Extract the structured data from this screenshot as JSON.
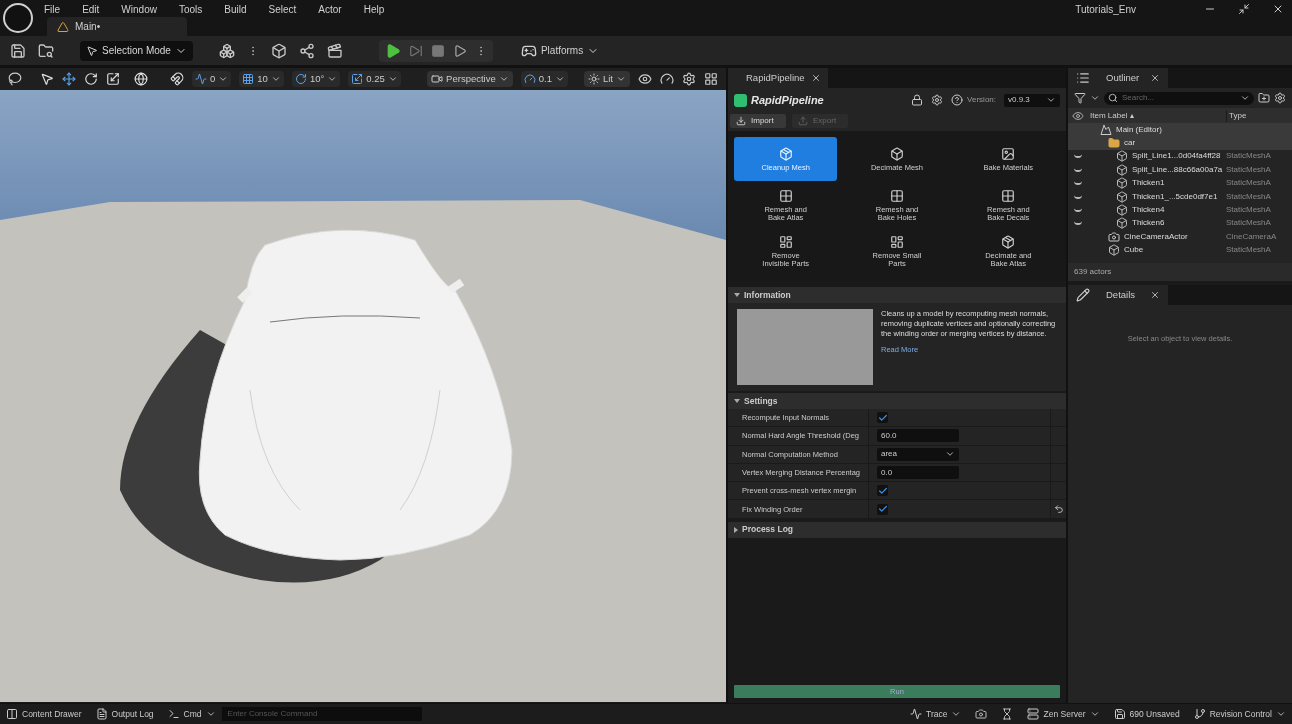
{
  "window": {
    "title": "Tutorials_Env"
  },
  "menu": [
    "File",
    "Edit",
    "Window",
    "Tools",
    "Build",
    "Select",
    "Actor",
    "Help"
  ],
  "document_tab": {
    "label": "Main•"
  },
  "toolbar": {
    "mode": "Selection Mode",
    "platforms": "Platforms"
  },
  "viewport_toolbar": {
    "rotate_snap": "0",
    "grid_snap": "10",
    "angle_snap": "10°",
    "scale_snap": "0.25",
    "view": "Perspective",
    "camera_speed": "0.1",
    "view_mode": "Lit"
  },
  "rapid_pipeline": {
    "tab": "RapidPipeline",
    "logo_text": "RapidPipeline",
    "version_label": "Version:",
    "version": "v0.9.3",
    "actions": [
      {
        "label": "Import",
        "disabled": false
      },
      {
        "label": "Export",
        "disabled": true
      }
    ],
    "tools": [
      {
        "label": "Cleanup Mesh",
        "selected": true
      },
      {
        "label": "Decimate Mesh",
        "selected": false
      },
      {
        "label": "Bake Materials",
        "selected": false
      },
      {
        "label": "Remesh and\nBake Atlas",
        "selected": false
      },
      {
        "label": "Remesh and\nBake Holes",
        "selected": false
      },
      {
        "label": "Remesh and\nBake Decals",
        "selected": false
      },
      {
        "label": "Remove\nInvisible Parts",
        "selected": false
      },
      {
        "label": "Remove Small\nParts",
        "selected": false
      },
      {
        "label": "Decimate and\nBake Atlas",
        "selected": false
      }
    ],
    "information": {
      "title": "Information",
      "expanded": true,
      "description": "Cleans up a model by recomputing mesh normals, removing duplicate vertices and optionally correcting the winding order or merging vertices by distance.",
      "link": "Read More"
    },
    "settings": {
      "title": "Settings",
      "expanded": true,
      "rows": [
        {
          "kind": "checkbox",
          "label": "Recompute Input Normals",
          "checked": true,
          "reset": false
        },
        {
          "kind": "number",
          "label": "Normal Hard Angle Threshold (Deg",
          "value": "60.0",
          "reset": false
        },
        {
          "kind": "select",
          "label": "Normal Computation Method",
          "value": "area",
          "reset": false
        },
        {
          "kind": "number",
          "label": "Vertex Merging Distance Percentag",
          "value": "0.0",
          "reset": false
        },
        {
          "kind": "checkbox",
          "label": "Prevent cross-mesh vertex mergin",
          "checked": true,
          "reset": false
        },
        {
          "kind": "checkbox",
          "label": "Fix Winding Order",
          "checked": true,
          "reset": true
        }
      ]
    },
    "process_log": {
      "title": "Process Log",
      "expanded": false
    },
    "run_button": "Run"
  },
  "outliner": {
    "tab": "Outliner",
    "search": {
      "placeholder": "Search..."
    },
    "columns": [
      "Item Label ▴",
      "Type"
    ],
    "rows": [
      {
        "label": "Main (Editor)",
        "kind": "level",
        "visible": false,
        "selected": true,
        "children": [
          {
            "label": "car",
            "kind": "folder",
            "visible": false,
            "selected": true,
            "children": [
              {
                "label": "Split_Line1...0d04fa4ff28",
                "type": "StaticMeshA",
                "kind": "mesh",
                "visible": true,
                "selected": false
              },
              {
                "label": "Split_Line...88c66a00a7a",
                "type": "StaticMeshA",
                "kind": "mesh",
                "visible": true,
                "selected": false
              },
              {
                "label": "Thicken1",
                "type": "StaticMeshA",
                "kind": "mesh",
                "visible": true,
                "selected": false
              },
              {
                "label": "Thicken1_...5cde0df7e1",
                "type": "StaticMeshA",
                "kind": "mesh",
                "visible": true,
                "selected": false
              },
              {
                "label": "Thicken4",
                "type": "StaticMeshA",
                "kind": "mesh",
                "visible": true,
                "selected": false
              },
              {
                "label": "Thicken6",
                "type": "StaticMeshA",
                "kind": "mesh",
                "visible": true,
                "selected": false
              }
            ]
          },
          {
            "label": "CineCameraActor",
            "type": "CineCameraA",
            "kind": "camera",
            "visible": false,
            "selected": false
          },
          {
            "label": "Cube",
            "type": "StaticMeshA",
            "kind": "mesh",
            "visible": false,
            "selected": false
          }
        ]
      }
    ],
    "footer": "639 actors"
  },
  "details": {
    "tab": "Details",
    "empty_message": "Select an object to view details."
  },
  "status_bar": {
    "content_drawer": "Content Drawer",
    "output_log": "Output Log",
    "cmd": "Cmd",
    "console": {
      "placeholder": "Enter Console Command"
    },
    "trace": "Trace",
    "zen_server": "Zen Server",
    "unsaved": "690 Unsaved",
    "revision_control": "Revision Control"
  }
}
